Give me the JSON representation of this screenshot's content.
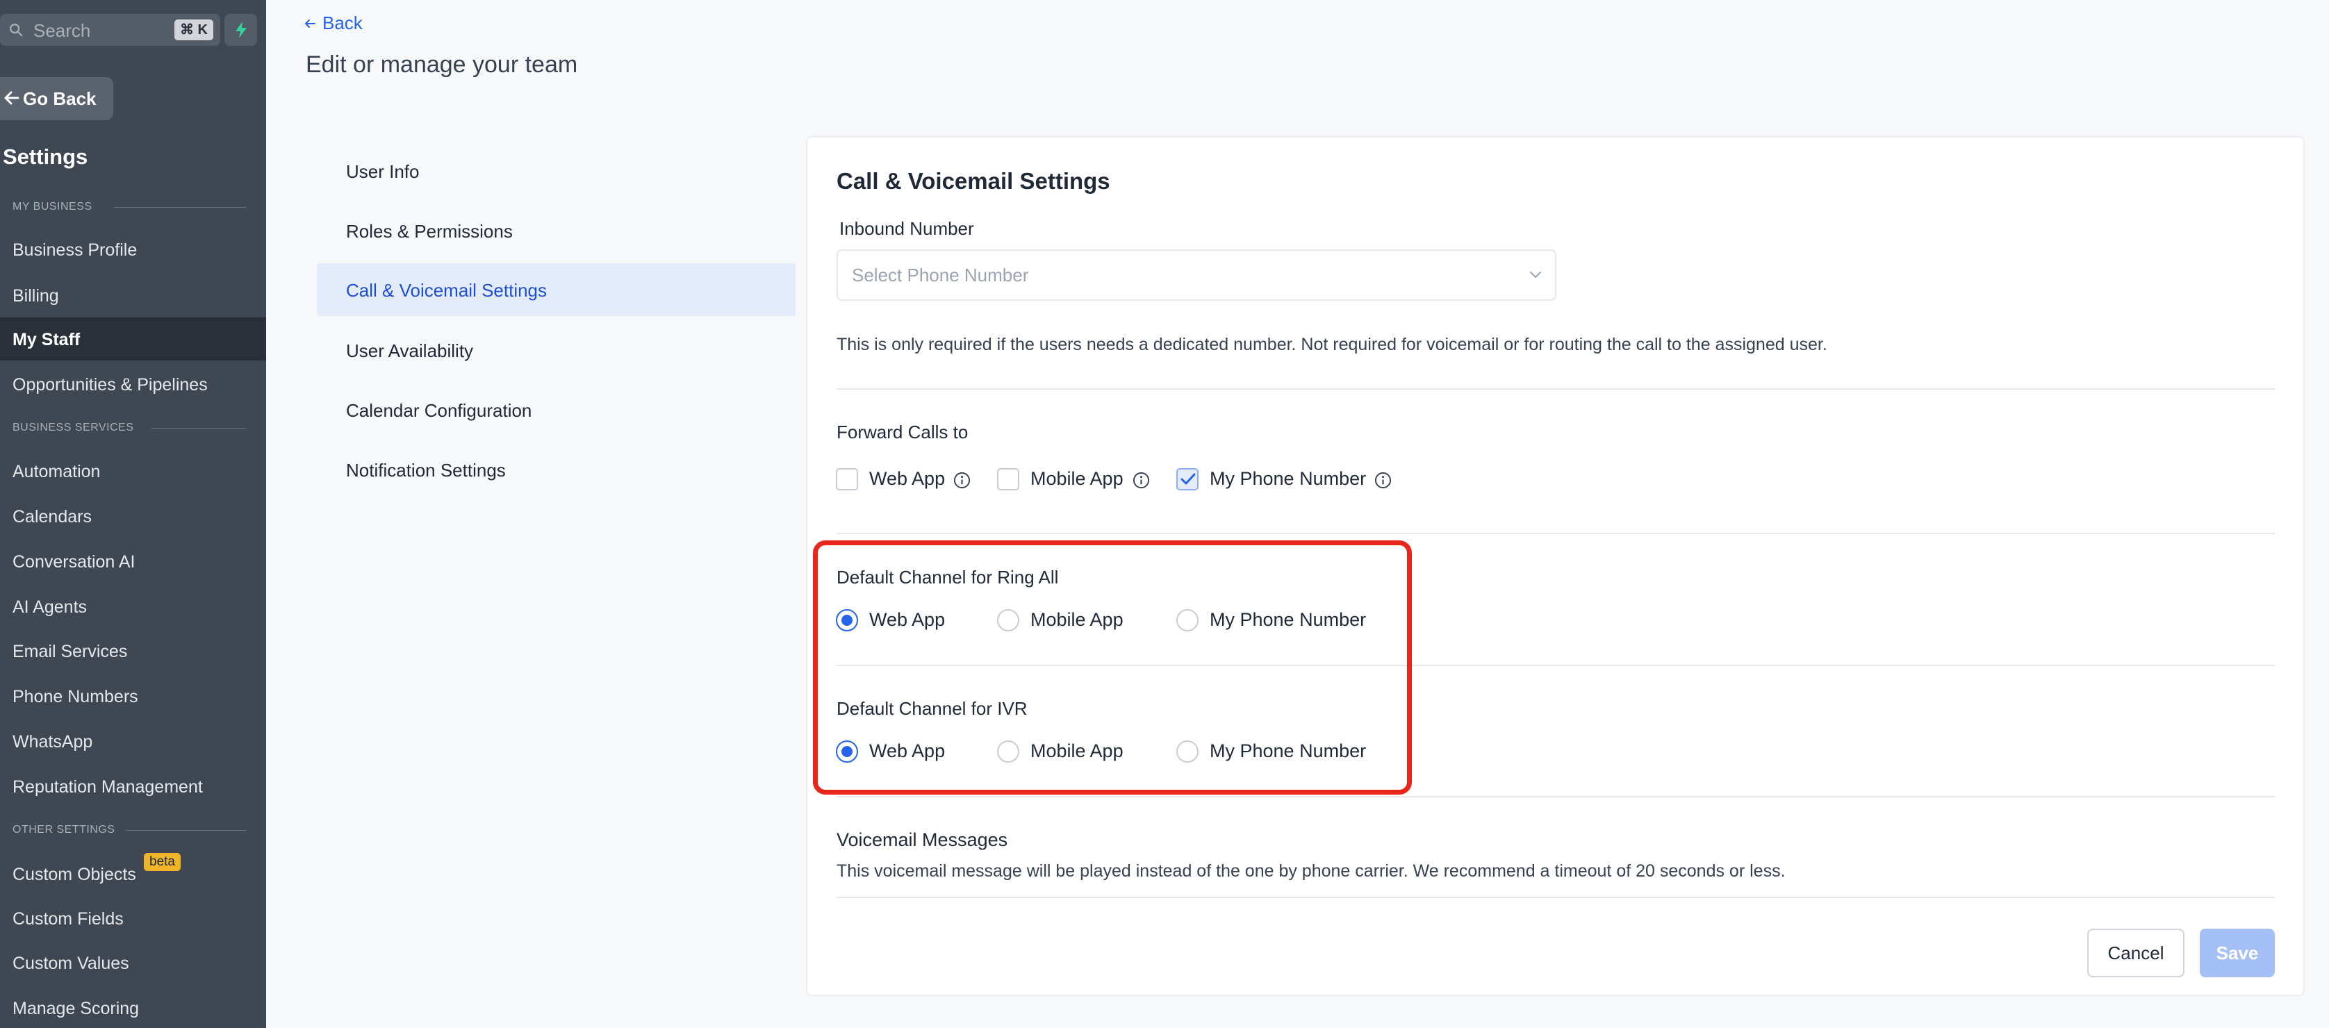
{
  "sidebar": {
    "search_placeholder": "Search",
    "search_shortcut": "⌘ K",
    "go_back_label": "Go Back",
    "title": "Settings",
    "section_my_business": "MY BUSINESS",
    "section_business_services": "BUSINESS SERVICES",
    "section_other_settings": "OTHER SETTINGS",
    "items": [
      {
        "label": "Business Profile"
      },
      {
        "label": "Billing"
      },
      {
        "label": "My Staff"
      },
      {
        "label": "Opportunities & Pipelines"
      },
      {
        "label": "Automation"
      },
      {
        "label": "Calendars"
      },
      {
        "label": "Conversation AI"
      },
      {
        "label": "AI Agents"
      },
      {
        "label": "Email Services"
      },
      {
        "label": "Phone Numbers"
      },
      {
        "label": "WhatsApp"
      },
      {
        "label": "Reputation Management"
      },
      {
        "label": "Custom Objects"
      },
      {
        "label": "Custom Fields"
      },
      {
        "label": "Custom Values"
      },
      {
        "label": "Manage Scoring"
      }
    ],
    "beta_badge": "beta",
    "active_item": "My Staff"
  },
  "header": {
    "back_label": "Back",
    "title": "Edit or manage your team"
  },
  "subnav": {
    "items": [
      {
        "label": "User Info"
      },
      {
        "label": "Roles & Permissions"
      },
      {
        "label": "Call & Voicemail Settings"
      },
      {
        "label": "User Availability"
      },
      {
        "label": "Calendar Configuration"
      },
      {
        "label": "Notification Settings"
      }
    ],
    "active_item": "Call & Voicemail Settings"
  },
  "card": {
    "title": "Call & Voicemail Settings",
    "inbound_number_label": "Inbound Number",
    "inbound_number_placeholder": "Select Phone Number",
    "inbound_helper": "This is only required if the users needs a dedicated number. Not required for voicemail or for routing the call to the assigned user.",
    "forward_calls_label": "Forward Calls to",
    "forward_options": [
      {
        "label": "Web App",
        "checked": false
      },
      {
        "label": "Mobile App",
        "checked": false
      },
      {
        "label": "My Phone Number",
        "checked": true
      }
    ],
    "ring_all_label": "Default Channel for Ring All",
    "ring_all_options": [
      {
        "label": "Web App",
        "selected": true
      },
      {
        "label": "Mobile App",
        "selected": false
      },
      {
        "label": "My Phone Number",
        "selected": false
      }
    ],
    "ivr_label": "Default Channel for IVR",
    "ivr_options": [
      {
        "label": "Web App",
        "selected": true
      },
      {
        "label": "Mobile App",
        "selected": false
      },
      {
        "label": "My Phone Number",
        "selected": false
      }
    ],
    "voicemail_label": "Voicemail Messages",
    "voicemail_helper": "This voicemail message will be played instead of the one by phone carrier. We recommend a timeout of 20 seconds or less.",
    "cancel_label": "Cancel",
    "save_label": "Save"
  },
  "colors": {
    "sidebar_bg": "#3f4752",
    "accent": "#2563eb",
    "highlight_border": "#e8261c",
    "save_disabled": "#a5bff7"
  }
}
